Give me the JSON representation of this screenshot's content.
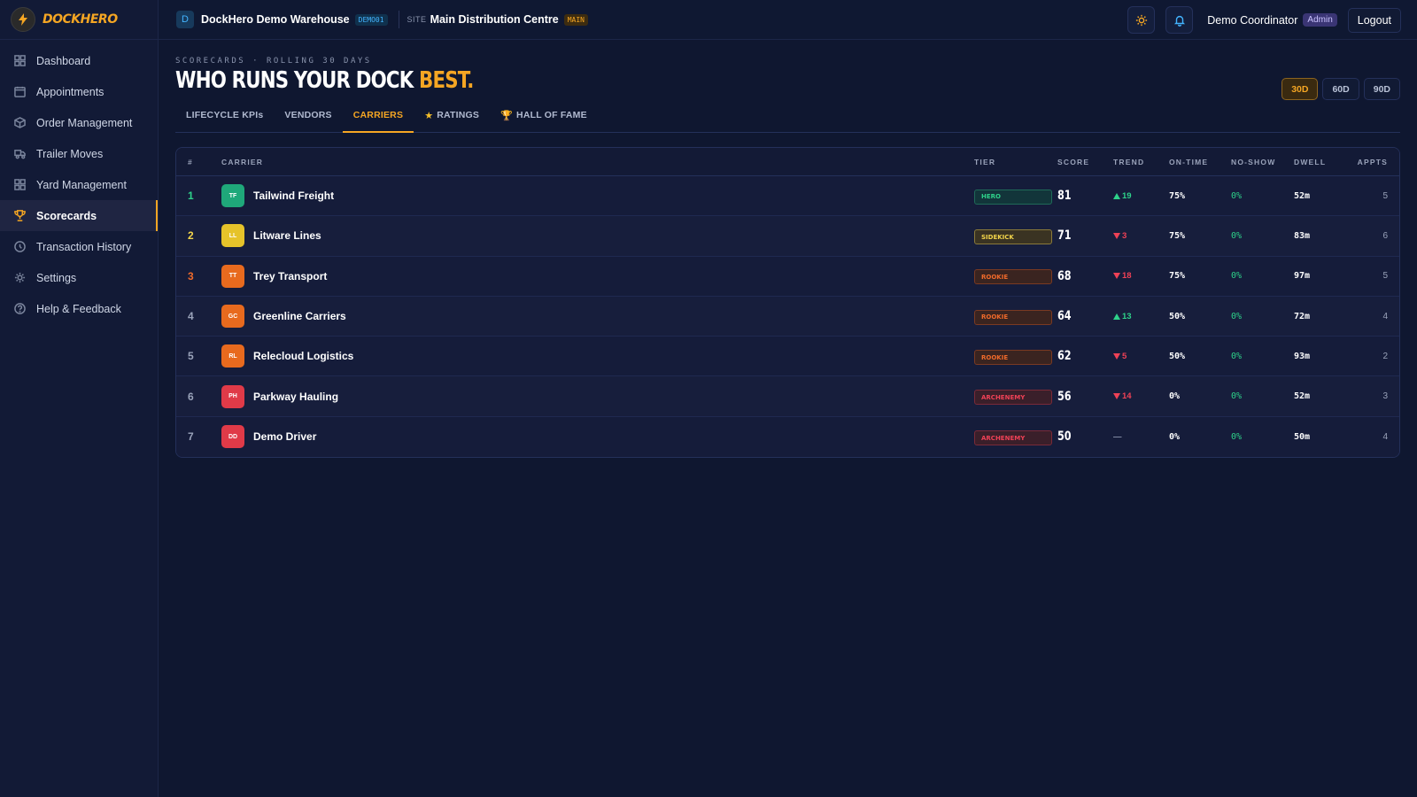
{
  "app": {
    "brand": "DOCKHERO"
  },
  "sidebar": {
    "items": [
      {
        "label": "Dashboard",
        "icon": "dashboard-icon"
      },
      {
        "label": "Appointments",
        "icon": "calendar-icon"
      },
      {
        "label": "Order Management",
        "icon": "box-icon"
      },
      {
        "label": "Trailer Moves",
        "icon": "truck-icon"
      },
      {
        "label": "Yard Management",
        "icon": "grid-icon"
      },
      {
        "label": "Scorecards",
        "icon": "trophy-icon",
        "active": true
      },
      {
        "label": "Transaction History",
        "icon": "history-icon"
      },
      {
        "label": "Settings",
        "icon": "gear-icon"
      },
      {
        "label": "Help & Feedback",
        "icon": "help-icon"
      }
    ]
  },
  "topbar": {
    "workspace_initial": "D",
    "workspace_name": "DockHero Demo Warehouse",
    "workspace_code": "DEMO01",
    "site_label": "SITE",
    "site_name": "Main Distribution Centre",
    "site_code": "MAIN",
    "user_name": "Demo Coordinator",
    "user_role": "Admin",
    "logout_label": "Logout"
  },
  "page": {
    "eyebrow": "SCORECARDS · ROLLING 30 DAYS",
    "headline_main": "WHO RUNS YOUR DOCK ",
    "headline_accent": "BEST.",
    "ranges": [
      "30D",
      "60D",
      "90D"
    ],
    "active_range": "30D",
    "tabs": [
      {
        "label": "LIFECYCLE KPIs",
        "icon": ""
      },
      {
        "label": "VENDORS",
        "icon": ""
      },
      {
        "label": "CARRIERS",
        "icon": "",
        "active": true
      },
      {
        "label": "RATINGS",
        "icon": "★"
      },
      {
        "label": "HALL OF FAME",
        "icon": "🏆"
      }
    ]
  },
  "table": {
    "columns": {
      "rank": "#",
      "carrier": "CARRIER",
      "tier": "TIER",
      "score": "SCORE",
      "trend": "TREND",
      "ontime": "ON-TIME",
      "noshow": "NO-SHOW",
      "dwell": "DWELL",
      "appts": "APPTS"
    },
    "rows": [
      {
        "rank": "1",
        "initials": "TF",
        "name": "Tailwind Freight",
        "tier": "HERO",
        "score": "81",
        "trend": "19",
        "trend_dir": "up",
        "ontime": "75%",
        "noshow": "0%",
        "dwell": "52m",
        "appts": "5",
        "rank_color": "#2ed28a",
        "avatar_color": "#1fa87a"
      },
      {
        "rank": "2",
        "initials": "LL",
        "name": "Litware Lines",
        "tier": "SIDEKICK",
        "score": "71",
        "trend": "3",
        "trend_dir": "down",
        "ontime": "75%",
        "noshow": "0%",
        "dwell": "83m",
        "appts": "6",
        "rank_color": "#f3d54a",
        "avatar_color": "#e6c32a"
      },
      {
        "rank": "3",
        "initials": "TT",
        "name": "Trey Transport",
        "tier": "ROOKIE",
        "score": "68",
        "trend": "18",
        "trend_dir": "down",
        "ontime": "75%",
        "noshow": "0%",
        "dwell": "97m",
        "appts": "5",
        "rank_color": "#f06a2a",
        "avatar_color": "#e86a1e"
      },
      {
        "rank": "4",
        "initials": "GC",
        "name": "Greenline Carriers",
        "tier": "ROOKIE",
        "score": "64",
        "trend": "13",
        "trend_dir": "up",
        "ontime": "50%",
        "noshow": "0%",
        "dwell": "72m",
        "appts": "4",
        "rank_color": "#9aa3ba",
        "avatar_color": "#e86a1e"
      },
      {
        "rank": "5",
        "initials": "RL",
        "name": "Relecloud Logistics",
        "tier": "ROOKIE",
        "score": "62",
        "trend": "5",
        "trend_dir": "down",
        "ontime": "50%",
        "noshow": "0%",
        "dwell": "93m",
        "appts": "2",
        "rank_color": "#9aa3ba",
        "avatar_color": "#e86a1e"
      },
      {
        "rank": "6",
        "initials": "PH",
        "name": "Parkway Hauling",
        "tier": "ARCHENEMY",
        "score": "56",
        "trend": "14",
        "trend_dir": "down",
        "ontime": "0%",
        "noshow": "0%",
        "dwell": "52m",
        "appts": "3",
        "rank_color": "#9aa3ba",
        "avatar_color": "#e03a48"
      },
      {
        "rank": "7",
        "initials": "DD",
        "name": "Demo Driver",
        "tier": "ARCHENEMY",
        "score": "50",
        "trend": "—",
        "trend_dir": "flat",
        "ontime": "0%",
        "noshow": "0%",
        "dwell": "50m",
        "appts": "4",
        "rank_color": "#9aa3ba",
        "avatar_color": "#e03a48"
      }
    ]
  }
}
